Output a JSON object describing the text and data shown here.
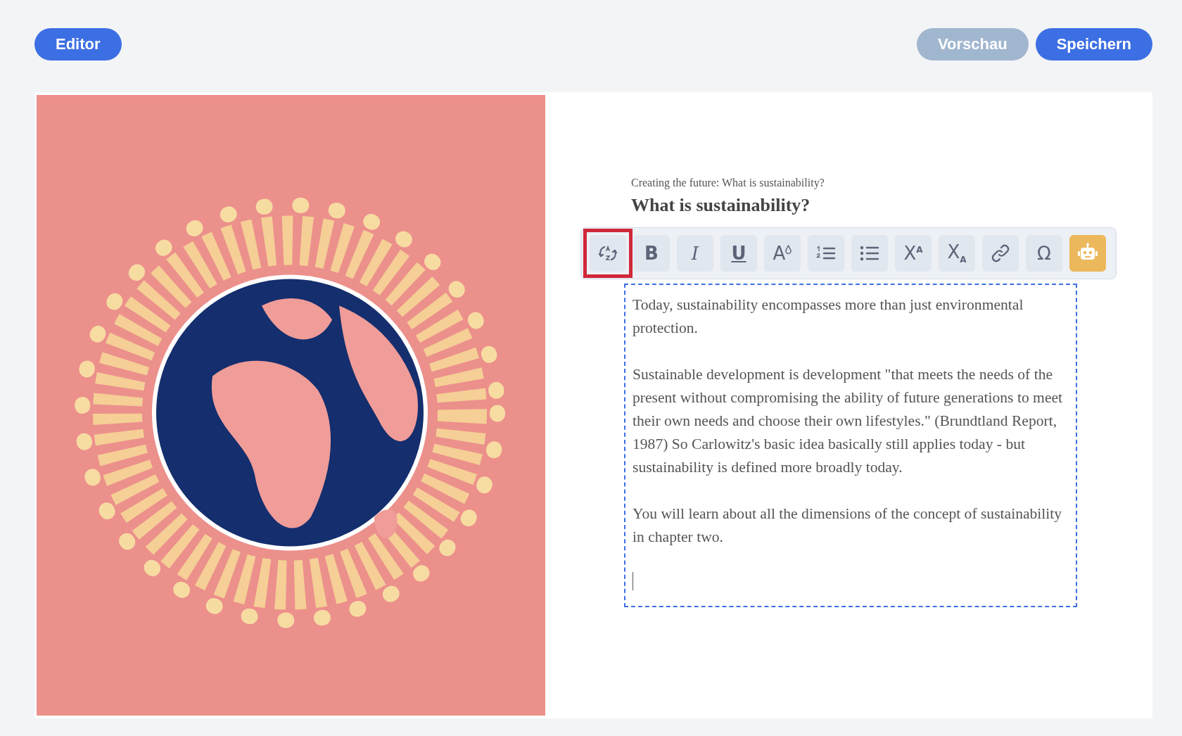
{
  "header": {
    "left_buttons": [
      {
        "label": "Editor",
        "kind": "primary"
      }
    ],
    "right_buttons": [
      {
        "label": "Vorschau",
        "kind": "secondary"
      },
      {
        "label": "Speichern",
        "kind": "primary"
      }
    ]
  },
  "page": {
    "caption": "Creating the future: What is sustainability?",
    "heading": "What is sustainability?",
    "toolbar": [
      {
        "kind": "translate",
        "outlined": true,
        "active": false
      },
      {
        "kind": "bold",
        "label": "B",
        "outlined": false,
        "active": false
      },
      {
        "kind": "italic",
        "label": "I",
        "outlined": false,
        "active": false
      },
      {
        "kind": "underline",
        "label": "U",
        "outlined": false,
        "active": false
      },
      {
        "kind": "color",
        "label": "A",
        "outlined": false,
        "active": false
      },
      {
        "kind": "ordered-list",
        "outlined": false,
        "active": false
      },
      {
        "kind": "bullet-list",
        "outlined": false,
        "active": false
      },
      {
        "kind": "superscript",
        "label": "X$^{A}$",
        "outlined": false,
        "active": false
      },
      {
        "kind": "subscript",
        "label": "X$_{A}$",
        "outlined": false,
        "active": false
      },
      {
        "kind": "link",
        "outlined": false,
        "active": false
      },
      {
        "kind": "special",
        "label": "Ω",
        "outlined": false,
        "active": false
      },
      {
        "kind": "robot",
        "outlined": false,
        "active": true
      }
    ],
    "paragraphs": [
      "Today, sustainability encompasses more than just environmental protection.",
      "Sustainable development is development \"that meets the needs of the present without compromising the ability of future generations to meet their own needs and choose their own lifestyles.\" (Brundtland Report, 1987) So Carlowitz's basic idea basically still applies today - but sustainability is defined more broadly today.",
      "You will learn about all the dimensions of the concept of sustainability in chapter two."
    ]
  }
}
